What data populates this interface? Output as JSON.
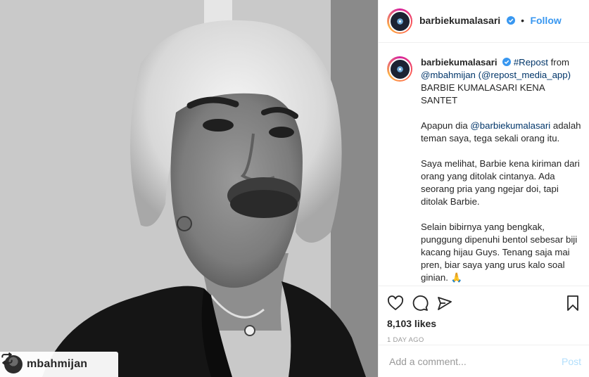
{
  "post": {
    "photo_alt": "",
    "repost_tag": {
      "icon": "repost-icon",
      "username": "mbahmijan"
    }
  },
  "header": {
    "username": "barbiekumalasari",
    "separator": "•",
    "follow_label": "Follow",
    "verified_icon": "verified-badge-icon"
  },
  "caption": {
    "username": "barbiekumalasari",
    "line1_tag": "#Repost",
    "line1_rest": " from",
    "mention1": "@mbahmijan",
    "mention2": "(@repost_media_app)",
    "headline": "BARBIE KUMALASARI KENA SANTET",
    "p1_mention": "@barbiekumalasari",
    "p1_rest": "adalah teman saya, tega sekali orang itu.",
    "p1_prefix": "Apapun dia ",
    "p2": "Saya melihat, Barbie kena kiriman dari orang yang ditolak cintanya. Ada seorang pria yang ngejar doi, tapi ditolak Barbie.",
    "p3": "Selain bibirnya yang bengkak, punggung dipenuhi bentol sebesar biji kacang hijau Guys. Tenang saja mai pren, biar saya yang urus kalo soal ginian. 🙏",
    "time_ago": "1d"
  },
  "actions": {
    "like_icon": "heart-icon",
    "comment_icon": "comment-bubble-icon",
    "share_icon": "share-icon",
    "save_icon": "bookmark-icon",
    "likes": "8,103 likes",
    "date": "1 DAY AGO"
  },
  "comment": {
    "placeholder": "Add a comment...",
    "post_label": "Post"
  },
  "colors": {
    "link_blue": "#3897f0",
    "text": "#262626",
    "muted": "#999999",
    "post_disabled": "#b2dffc"
  }
}
